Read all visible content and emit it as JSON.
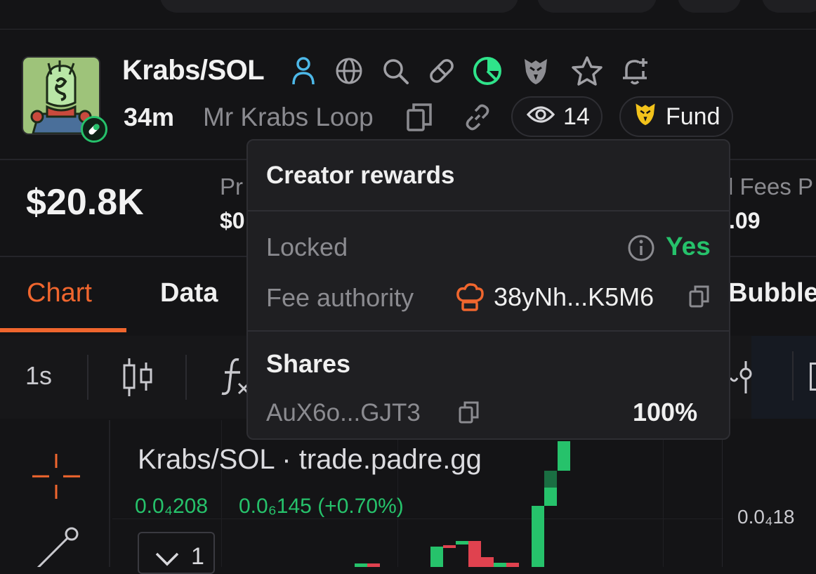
{
  "header": {
    "title": "Krabs/SOL",
    "age": "34m",
    "token_name": "Mr Krabs Loop",
    "watchers": "14",
    "fund_label": "Fund"
  },
  "stats": {
    "market_cap": "$20.8K",
    "price_label_partial": "Pr",
    "price_value_partial": "$0",
    "fees_label_partial": "l Fees P",
    "fees_value_partial": ".09"
  },
  "tabs": [
    {
      "label": "Chart",
      "active": true
    },
    {
      "label": "Data",
      "active": false
    },
    {
      "label": "Bubble",
      "active": false
    }
  ],
  "toolbar": {
    "interval": "1s"
  },
  "chart": {
    "title": "Krabs/SOL · trade.padre.gg",
    "ohlc_price": "0.0₄208",
    "ohlc_change": "0.0₆145 (+0.70%)",
    "price_axis_label": "0.0₄18",
    "collapse_value": "1"
  },
  "popover": {
    "title": "Creator rewards",
    "locked_label": "Locked",
    "locked_value": "Yes",
    "fee_authority_label": "Fee authority",
    "fee_authority_value": "38yNh...K5M6",
    "shares_title": "Shares",
    "share_address": "AuX6o...GJT3",
    "share_percent": "100%"
  },
  "colors": {
    "accent_orange": "#f0662e",
    "green": "#26c26b",
    "cyan": "#4db8e8",
    "red": "#e0424f",
    "muted": "#8b8b90"
  },
  "icons": [
    "user-icon",
    "globe-icon",
    "search-icon",
    "pill-icon",
    "pie-chart-icon",
    "eagle-icon",
    "star-icon",
    "bell-plus-icon",
    "copy-icon",
    "link-icon",
    "eye-icon",
    "info-icon",
    "chef-hat-icon",
    "crosshair-icon",
    "trend-line-icon",
    "candles-icon",
    "function-icon",
    "chevron-down-icon"
  ]
}
